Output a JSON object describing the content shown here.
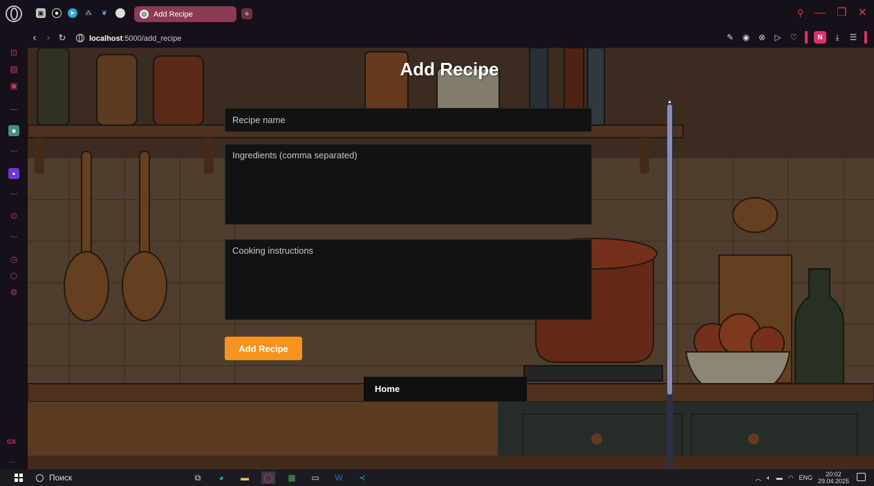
{
  "browser": {
    "tab": {
      "title": "Add Recipe",
      "new_tab_label": "+"
    },
    "address": {
      "host": "localhost",
      "path": ":5000/add_recipe"
    },
    "profile_initial": "N",
    "accent_color": "#e0335d",
    "tab_color": "#8c3b52"
  },
  "page": {
    "title": "Add Recipe",
    "form": {
      "name_placeholder": "Recipe name",
      "ingredients_placeholder": "Ingredients (comma separated)",
      "instructions_placeholder": "Cooking instructions",
      "submit_label": "Add Recipe",
      "submit_color": "#f7931e"
    },
    "home_link": "Home"
  },
  "sidebar": {
    "gx_label": "GX",
    "more_label": "..."
  },
  "taskbar": {
    "search_placeholder": "Поиск",
    "language": "ENG",
    "time": "20:02",
    "date": "29.04.2025"
  }
}
